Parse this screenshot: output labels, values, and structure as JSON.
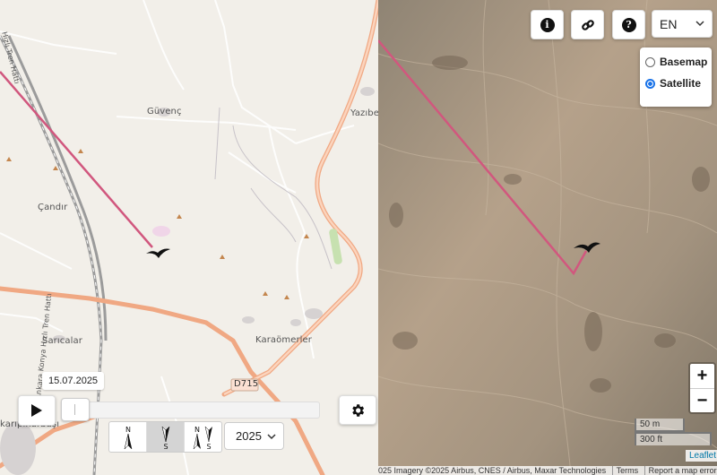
{
  "map_left": {
    "places": {
      "guvenc": "Güvenç",
      "yazibel": "Yazıbel",
      "candir": "Çandır",
      "saricalar": "Sarıcalar",
      "karaomerler": "Karaömerler",
      "karpinarbasi": "karıpınarbaşı",
      "rail": "Hızlı Tren Hattı",
      "rail2": "Ankara Konya Hızlı Tren Hattı",
      "road": "D715"
    }
  },
  "map_right": {
    "layers": {
      "basemap": "Basemap",
      "satellite": "Satellite",
      "selected": "Satellite"
    },
    "zoom": {
      "in": "+",
      "out": "−"
    },
    "scale": {
      "metric": "50 m",
      "imperial": "300 ft"
    },
    "attribution": [
      "025 Imagery ©2025 Airbus, CNES / Airbus, Maxar Technologies",
      "Terms",
      "Report a map error"
    ],
    "leaflet": "Leaflet"
  },
  "toolbar": {
    "info_icon": "info-icon",
    "link_icon": "link-icon",
    "help_icon": "help-icon",
    "language": "EN"
  },
  "timeline": {
    "date": "15.07.2025",
    "position": 0.03,
    "year": "2025",
    "compass": [
      {
        "top": "N",
        "bottom": ""
      },
      {
        "top": "",
        "bottom": "S"
      },
      {
        "top": "N",
        "bottom": "S"
      }
    ]
  },
  "colors": {
    "track": "#d1577e",
    "road_orange": "#f0a883",
    "accent": "#1a73e8"
  }
}
